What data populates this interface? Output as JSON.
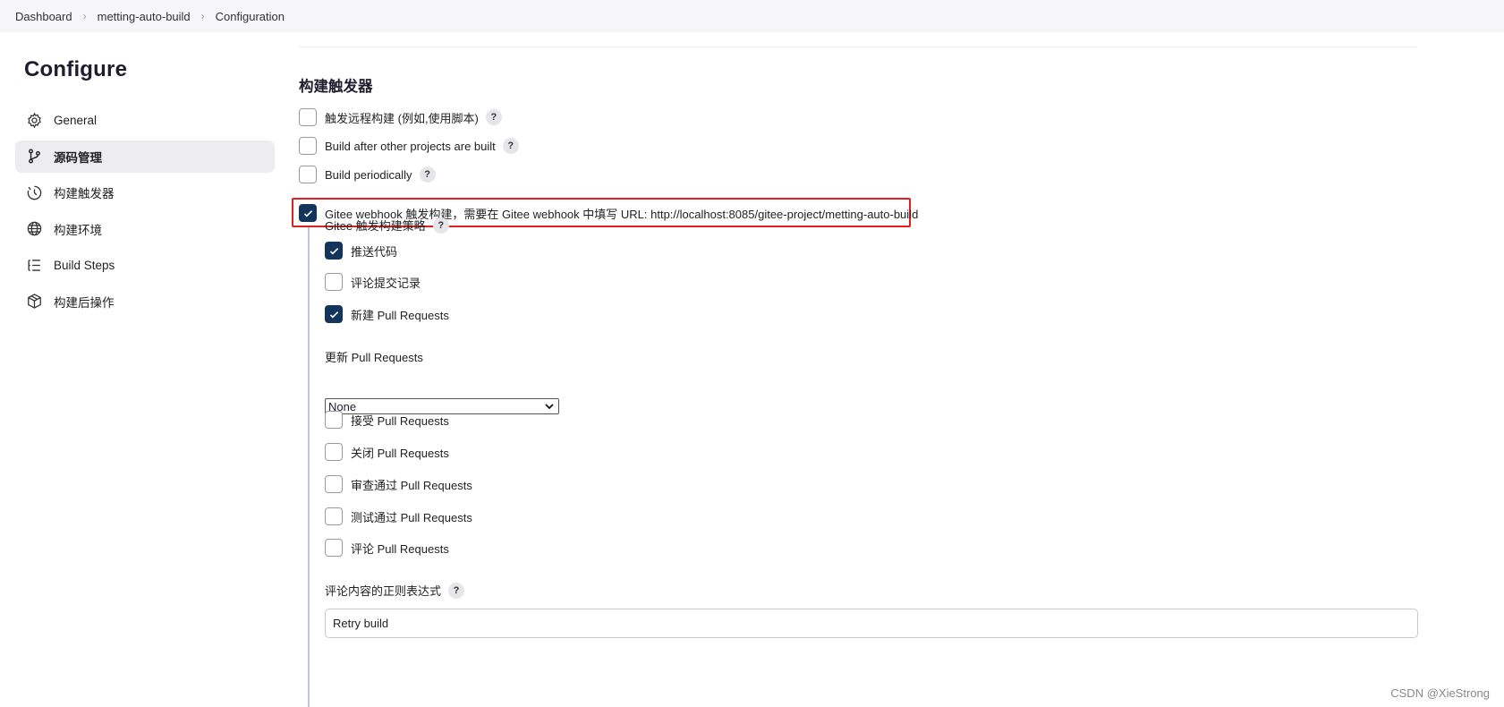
{
  "breadcrumb": [
    "Dashboard",
    "metting-auto-build",
    "Configuration"
  ],
  "sidebar": {
    "title": "Configure",
    "items": [
      {
        "label": "General",
        "icon": "gear-icon",
        "active": false
      },
      {
        "label": "源码管理",
        "icon": "branch-icon",
        "active": true
      },
      {
        "label": "构建触发器",
        "icon": "clock-icon",
        "active": false
      },
      {
        "label": "构建环境",
        "icon": "globe-icon",
        "active": false
      },
      {
        "label": "Build Steps",
        "icon": "list-icon",
        "active": false
      },
      {
        "label": "构建后操作",
        "icon": "package-icon",
        "active": false
      }
    ]
  },
  "section": {
    "title": "构建触发器"
  },
  "triggers": [
    {
      "label": "触发远程构建 (例如,使用脚本)",
      "checked": false,
      "help": "?"
    },
    {
      "label": "Build after other projects are built",
      "checked": false,
      "help": "?"
    },
    {
      "label": "Build periodically",
      "checked": false,
      "help": "?"
    },
    {
      "label": "Gitee webhook 触发构建，需要在 Gitee webhook 中填写 URL: http://localhost:8085/gitee-project/metting-auto-build",
      "checked": true
    }
  ],
  "gitee": {
    "strategy_label": "Gitee 触发构建策略",
    "strategy_help": "?",
    "options_top": [
      {
        "label": "推送代码",
        "checked": true
      },
      {
        "label": "评论提交记录",
        "checked": false
      },
      {
        "label": "新建 Pull Requests",
        "checked": true
      }
    ],
    "update_pr_label": "更新 Pull Requests",
    "update_pr_value": "None",
    "options_bottom": [
      {
        "label": "接受 Pull Requests",
        "checked": false
      },
      {
        "label": "关闭 Pull Requests",
        "checked": false
      },
      {
        "label": "审查通过 Pull Requests",
        "checked": false
      },
      {
        "label": "测试通过 Pull Requests",
        "checked": false
      },
      {
        "label": "评论 Pull Requests",
        "checked": false
      }
    ],
    "regex_label": "评论内容的正则表达式",
    "regex_help": "?",
    "regex_value": "Retry build"
  },
  "watermark": "CSDN @XieStrong",
  "colors": {
    "checked": "#13355b",
    "highlight": "#e02020",
    "active_nav": "#ededf0"
  }
}
